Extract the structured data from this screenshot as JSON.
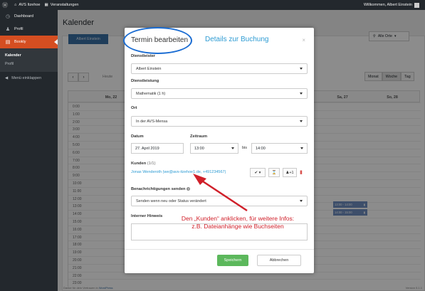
{
  "adminbar": {
    "site": "AVS Itzehoe",
    "section": "Veranstaltungen",
    "welcome": "Willkommen, Albert Einstein"
  },
  "sidebar": {
    "items": [
      {
        "label": "Dashboard",
        "icon": "dashboard-icon"
      },
      {
        "label": "Profil",
        "icon": "user-icon"
      },
      {
        "label": "Bookly",
        "icon": "bookly-icon"
      }
    ],
    "sub": [
      "Kalender",
      "Profil"
    ],
    "collapse": "Menü einklappen"
  },
  "page": {
    "title": "Kalender",
    "staff_button": "Albert Einstein",
    "location": "Alle Orte",
    "today": "Heute",
    "views": [
      "Monat",
      "Woche",
      "Tag"
    ],
    "active_view": "Woche",
    "days": [
      {
        "label": "Mo, 22"
      },
      {
        "label": "Sa, 27"
      },
      {
        "label": "So, 28"
      }
    ],
    "hours": [
      "0:00",
      "1:00",
      "2:00",
      "3:00",
      "4:00",
      "5:00",
      "6:00",
      "7:00",
      "8:00",
      "9:00",
      "10:00",
      "11:00",
      "12:00",
      "13:00",
      "14:00",
      "15:00",
      "16:00",
      "17:00",
      "18:00",
      "19:00",
      "20:00",
      "21:00",
      "22:00",
      "23:00"
    ],
    "appointments": [
      "13:00 - 14:00",
      "14:00 - 15:00"
    ],
    "footer_text": "Danke für dein Vertrauen in",
    "footer_link": "WordPress",
    "version": "Version 5.1.1"
  },
  "modal": {
    "tab_active": "Termin bearbeiten",
    "tab_other": "Details zur Buchung",
    "close": "×",
    "dienstleister_label": "Dienstleister",
    "dienstleister_value": "Albert Einstein",
    "dienstleistung_label": "Dienstleistung",
    "dienstleistung_value": "Mathematik (1 h)",
    "ort_label": "Ort",
    "ort_value": "In der AVS-Mensa",
    "datum_label": "Datum",
    "datum_value": "27. April 2019",
    "zeitraum_label": "Zeitraum",
    "time_from": "13:00",
    "bis": "bis",
    "time_to": "14:00",
    "kunden_label": "Kunden",
    "kunden_count": "(1/1)",
    "customer": "Jonas Wenderoth (we@avs-itzehoe1.de, +491234567)",
    "customer_status": "✔ ▾",
    "customer_payment": "⌛",
    "customer_extra": "+1",
    "notify_label": "Benachrichtigungen senden",
    "notify_value": "Senden wenn neu oder Status verändert",
    "note_label": "Interner Hinweis",
    "save": "Speichern",
    "cancel": "Abbrechen"
  },
  "annotation": {
    "line1": "Den „Kunden“ anklicken, für weitere Infos:",
    "line2": "z.B. Dateianhänge wie Buchseiten",
    "color": "#d0202a"
  },
  "colors": {
    "accent": "#2d9bd3",
    "wp_dark": "#23282d",
    "active_menu": "#d54e21",
    "save": "#5cb85c",
    "highlight_ring": "#1a6cd2"
  }
}
